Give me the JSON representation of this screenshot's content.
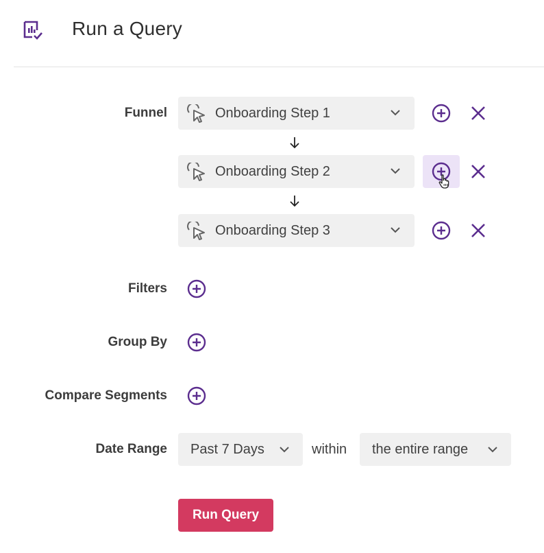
{
  "header": {
    "title": "Run a Query",
    "icon": "report-icon",
    "accent": "#5b2d8e"
  },
  "funnel": {
    "label": "Funnel",
    "steps": [
      {
        "label": "Onboarding Step 1"
      },
      {
        "label": "Onboarding Step 2"
      },
      {
        "label": "Onboarding Step 3"
      }
    ]
  },
  "filters": {
    "label": "Filters"
  },
  "group_by": {
    "label": "Group By"
  },
  "compare": {
    "label": "Compare Segments"
  },
  "date_range": {
    "label": "Date Range",
    "range_value": "Past 7 Days",
    "within_label": "within",
    "scope_value": "the entire range"
  },
  "run_button": {
    "label": "Run Query",
    "color": "#d33a60"
  },
  "colors": {
    "accent": "#5b2d8e",
    "field_bg": "#f0f0f0",
    "hover_bg": "#ece3f7"
  }
}
